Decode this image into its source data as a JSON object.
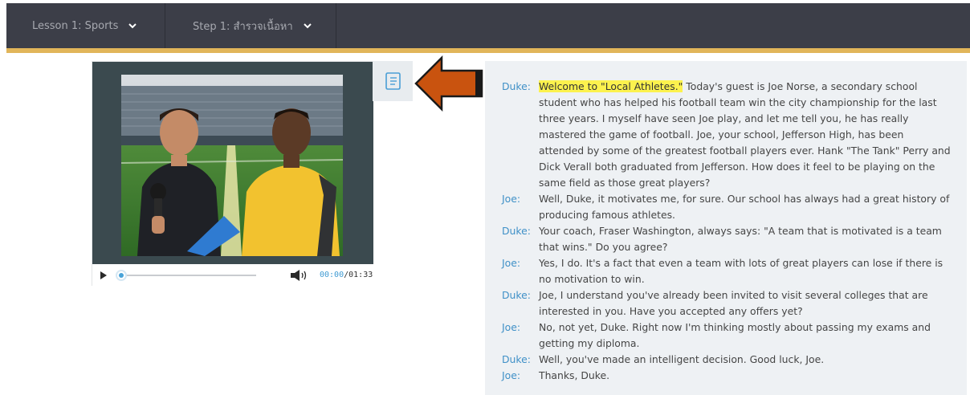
{
  "nav": {
    "lesson_label": "Lesson 1: Sports",
    "step_label": "Step 1: สำรวจเนื้อหา"
  },
  "player": {
    "current_time": "00:00",
    "separator": "/",
    "duration": "01:33",
    "progress": 0
  },
  "transcript": {
    "lines": [
      {
        "speaker": "Duke:",
        "highlight": "Welcome to \"Local Athletes.\"",
        "text": " Today's guest is Joe Norse, a secondary school student who has helped his football team win the city championship for the last three years. I myself have seen Joe play, and let me tell you, he has really mastered the game of football. Joe, your school, Jefferson High, has been attended by some of the greatest football players ever. Hank \"The Tank\" Perry and Dick Verall both graduated from Jefferson. How does it feel to be playing on the same field as those great players?"
      },
      {
        "speaker": "Joe:",
        "highlight": "",
        "text": "Well, Duke, it motivates me, for sure. Our school has always had a great history of producing famous athletes."
      },
      {
        "speaker": "Duke:",
        "highlight": "",
        "text": "Your coach, Fraser Washington, always says: \"A team that is motivated is a team that wins.\" Do you agree?"
      },
      {
        "speaker": "Joe:",
        "highlight": "",
        "text": "Yes, I do. It's a fact that even a team with lots of great players can lose if there is no motivation to win."
      },
      {
        "speaker": "Duke:",
        "highlight": "",
        "text": "Joe, I understand you've already been invited to visit several colleges that are interested in you. Have you accepted any offers yet?"
      },
      {
        "speaker": "Joe:",
        "highlight": "",
        "text": "No, not yet, Duke. Right now I'm thinking mostly about passing my exams and getting my diploma."
      },
      {
        "speaker": "Duke:",
        "highlight": "",
        "text": "Well, you've made an intelligent decision. Good luck, Joe."
      },
      {
        "speaker": "Joe:",
        "highlight": "",
        "text": "Thanks, Duke."
      }
    ]
  },
  "colors": {
    "nav_bg": "#3c3e48",
    "accent_gold": "#e1b55a",
    "speaker_blue": "#3f90c7",
    "highlight": "#fcf24e",
    "arrow_orange": "#c9530f"
  },
  "icons": {
    "lesson_chevron": "chevron-down-icon",
    "step_chevron": "chevron-down-icon",
    "transcript": "transcript-scroll-icon",
    "play": "play-icon",
    "volume": "volume-icon"
  }
}
